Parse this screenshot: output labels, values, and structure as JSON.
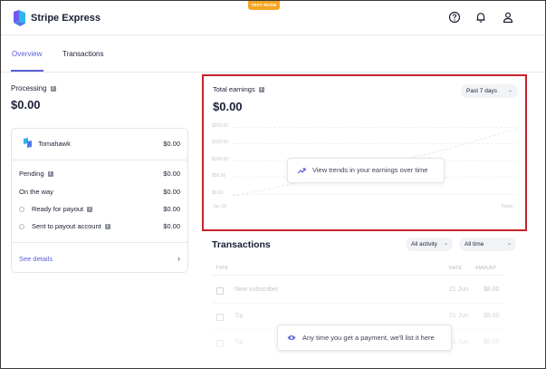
{
  "header": {
    "brand": "Stripe Express",
    "test_mode_badge": "TEST MODE",
    "icons": [
      "help-icon",
      "bell-icon",
      "user-icon"
    ]
  },
  "tabs": [
    {
      "label": "Overview",
      "active": true
    },
    {
      "label": "Transactions",
      "active": false
    }
  ],
  "processing": {
    "label": "Processing",
    "amount": "$0.00",
    "account": {
      "name": "Tomahawk",
      "amount": "$0.00"
    },
    "rows": {
      "pending": {
        "label": "Pending",
        "amount": "$0.00"
      },
      "on_the_way": {
        "label": "On the way",
        "amount": "$0.00"
      },
      "ready_for_payout": {
        "label": "Ready for payout",
        "amount": "$0.00"
      },
      "sent_to_payout_account": {
        "label": "Sent to payout account",
        "amount": "$0.00"
      }
    },
    "see_details": "See details"
  },
  "earnings": {
    "label": "Total earnings",
    "amount": "$0.00",
    "range": "Past 7 days",
    "y_ticks": [
      "$200.00",
      "$150.00",
      "$100.00",
      "$50.00",
      "$0.00"
    ],
    "x_ticks": [
      "Jun 15",
      "Today"
    ],
    "empty_message": "View trends in your earnings over time"
  },
  "transactions": {
    "title": "Transactions",
    "filters": {
      "activity": "All activity",
      "time": "All time"
    },
    "columns": {
      "type": "TYPE",
      "date": "DATE",
      "amount": "AMOUNT"
    },
    "rows": [
      {
        "type": "New subscriber",
        "date": "21 Jun",
        "amount": "$8.00"
      },
      {
        "type": "Tip",
        "date": "21 Jun",
        "amount": "$8.00"
      },
      {
        "type": "Tip",
        "date": "21 Jun",
        "amount": "$8.00"
      }
    ],
    "empty_message": "Any time you get a payment, we'll list it here"
  },
  "colors": {
    "accent": "#5a5fd6",
    "highlight_border": "#c8232c",
    "test_badge": "#f5a623"
  }
}
